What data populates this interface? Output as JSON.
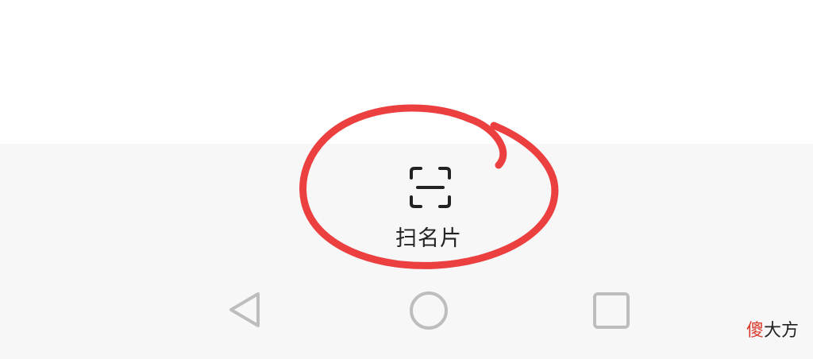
{
  "scan_button": {
    "label": "扫名片",
    "icon": "scan-frame-icon"
  },
  "annotation": {
    "color": "#ec3f3f"
  },
  "nav_bar": {
    "buttons": [
      {
        "icon": "back-triangle-icon"
      },
      {
        "icon": "home-circle-icon"
      },
      {
        "icon": "recent-apps-square-icon"
      }
    ],
    "icon_color": "#bdbdbd"
  },
  "watermark": {
    "first_char": "傻",
    "rest": "大方",
    "accent_color": "#d83a2a"
  }
}
